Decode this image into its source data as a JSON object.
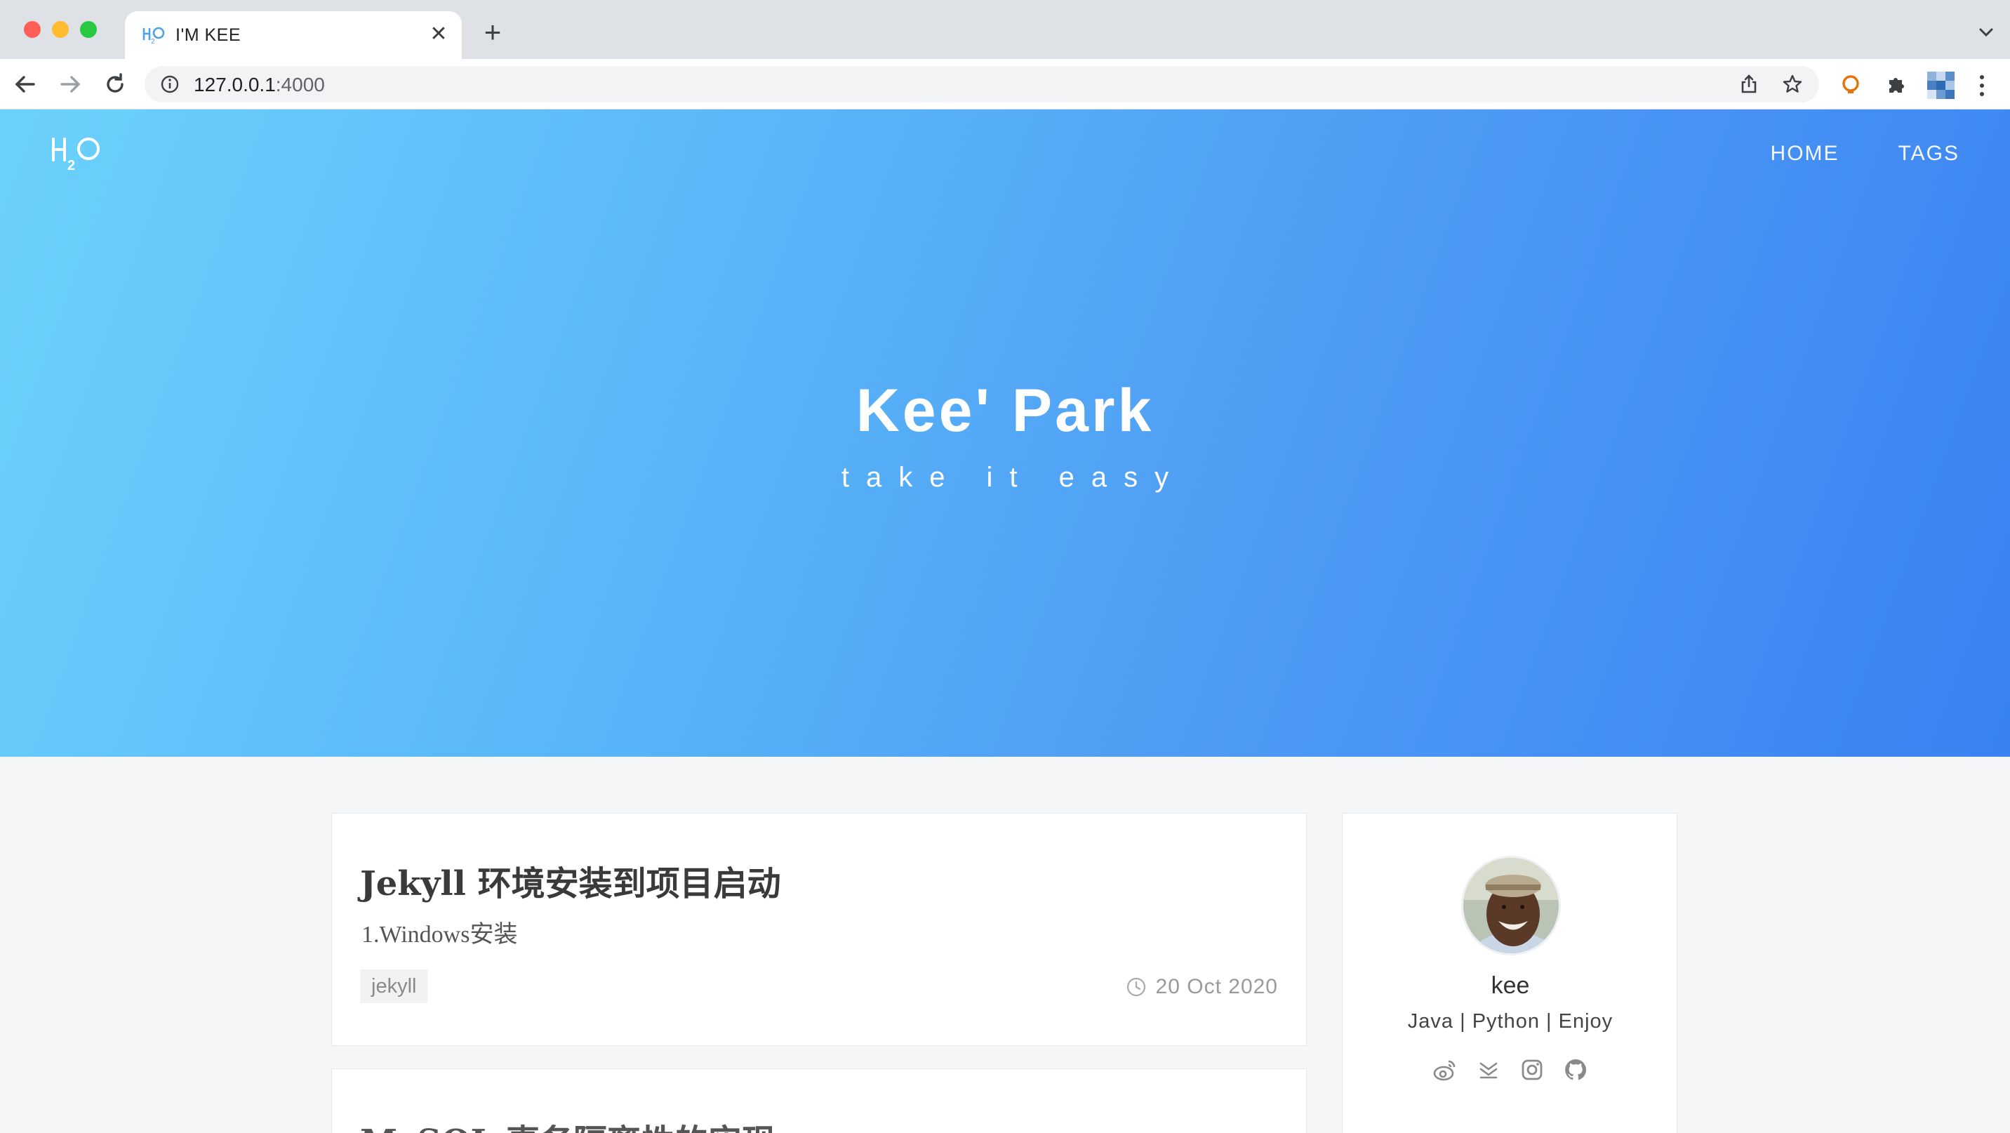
{
  "browser": {
    "tab_title": "I'M KEE",
    "close_glyph": "✕",
    "new_tab_glyph": "+",
    "url_host": "127.0.0.1",
    "url_port": ":4000"
  },
  "site": {
    "logo": "H2O",
    "nav": [
      {
        "label": "HOME"
      },
      {
        "label": "TAGS"
      }
    ],
    "hero_title": "Kee' Park",
    "hero_subtitle": "take it easy"
  },
  "posts": [
    {
      "title": "Jekyll 环境安装到项目启动",
      "excerpt": "1.Windows安装",
      "tag": "jekyll",
      "date": "20 Oct 2020"
    },
    {
      "title": "MySQL 事务隔离性的实现"
    }
  ],
  "sidebar": {
    "name": "kee",
    "description": "Java | Python | Enjoy",
    "social_icons": [
      "weibo-icon",
      "zhihu-icon",
      "instagram-icon",
      "github-icon"
    ]
  },
  "colors": {
    "hero_start": "#6bd2fb",
    "hero_end": "#3a82f2",
    "tab_bar": "#dee1e6"
  }
}
